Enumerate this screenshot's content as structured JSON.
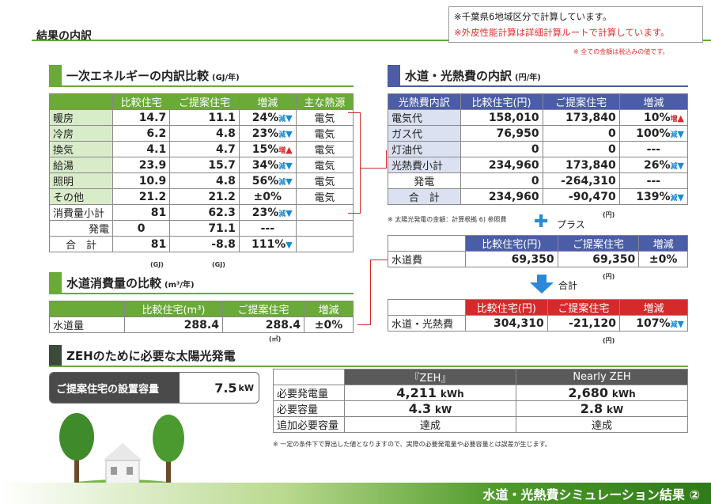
{
  "header": {
    "title": "結果の内訳",
    "note1": "※千葉県6地域区分で計算しています。",
    "note2": "※外皮性能計算は詳細計算ルートで計算しています。",
    "tax_note": "※ 全ての金額は税込みの値です。"
  },
  "energy": {
    "title": "一次エネルギーの内訳比較",
    "unit": "(GJ/年)",
    "headers": [
      "",
      "比較住宅",
      "ご提案住宅",
      "増減",
      "主な熱源"
    ],
    "rows": [
      {
        "label": "暖房",
        "a": "14.7",
        "b": "11.1",
        "pct": "24%",
        "tag": "減",
        "arrow": "▼",
        "src": "電気"
      },
      {
        "label": "冷房",
        "a": "6.2",
        "b": "4.8",
        "pct": "23%",
        "tag": "減",
        "arrow": "▼",
        "src": "電気"
      },
      {
        "label": "換気",
        "a": "4.1",
        "b": "4.7",
        "pct": "15%",
        "tag": "増",
        "arrow": "▲",
        "src": "電気"
      },
      {
        "label": "給湯",
        "a": "23.9",
        "b": "15.7",
        "pct": "34%",
        "tag": "減",
        "arrow": "▼",
        "src": "電気"
      },
      {
        "label": "照明",
        "a": "10.9",
        "b": "4.8",
        "pct": "56%",
        "tag": "減",
        "arrow": "▼",
        "src": "電気"
      },
      {
        "label": "その他",
        "a": "21.2",
        "b": "21.2",
        "pct": "±0%",
        "tag": "",
        "arrow": "",
        "src": "電気"
      }
    ],
    "subtotal": {
      "label": "消費量小計",
      "a": "81",
      "b": "62.3",
      "pct": "23%",
      "tag": "減",
      "arrow": "▼"
    },
    "gen": {
      "label": "発電",
      "a": "0",
      "b": "71.1",
      "pct": "---"
    },
    "total": {
      "label": "合　計",
      "a": "81",
      "b": "-8.8",
      "pct": "111%",
      "tag": "減",
      "arrow": "▼"
    },
    "unit_a": "(GJ)",
    "unit_b": "(GJ)"
  },
  "water": {
    "title": "水道消費量の比較",
    "unit": "(m³/年)",
    "headers": [
      "",
      "比較住宅(m³)",
      "ご提案住宅",
      "増減"
    ],
    "row": {
      "label": "水道量",
      "a": "288.4",
      "b": "288.4",
      "pct": "±0%"
    },
    "unit_note": "(㎥)"
  },
  "utility": {
    "title": "水道・光熱費の内訳",
    "unit": "(円/年)",
    "headers": [
      "光熱費内訳",
      "比較住宅(円)",
      "ご提案住宅",
      "増減"
    ],
    "rows": [
      {
        "label": "電気代",
        "a": "158,010",
        "b": "173,840",
        "pct": "10%",
        "tag": "増",
        "arrow": "▲"
      },
      {
        "label": "ガス代",
        "a": "76,950",
        "b": "0",
        "pct": "100%",
        "tag": "減",
        "arrow": "▼"
      },
      {
        "label": "灯油代",
        "a": "0",
        "b": "0",
        "pct": "---",
        "tag": "",
        "arrow": ""
      },
      {
        "label": "光熱費小計",
        "a": "234,960",
        "b": "173,840",
        "pct": "26%",
        "tag": "減",
        "arrow": "▼"
      },
      {
        "label": "発電",
        "a": "0",
        "b": "-264,310",
        "pct": "---",
        "tag": "",
        "arrow": ""
      },
      {
        "label": "合　計",
        "a": "234,960",
        "b": "-90,470",
        "pct": "139%",
        "tag": "減",
        "arrow": "▼"
      }
    ],
    "yen1": "(円)",
    "solar_note": "※ 太陽光発電の金額：計算根拠 6) 参照費",
    "plus": "プラス"
  },
  "waterfee": {
    "headers": [
      "",
      "比較住宅(円)",
      "ご提案住宅",
      "増減"
    ],
    "row": {
      "label": "水道費",
      "a": "69,350",
      "b": "69,350",
      "pct": "±0%"
    },
    "yen": "(円)",
    "sum_label": "合計"
  },
  "grand": {
    "headers": [
      "",
      "比較住宅(円)",
      "ご提案住宅",
      "増減"
    ],
    "row": {
      "label": "水道・光熱費",
      "a": "304,310",
      "b": "-21,120",
      "pct": "107%",
      "tag": "減",
      "arrow": "▼"
    },
    "yen": "(円)"
  },
  "zeh": {
    "title": "ZEHのために必要な太陽光発電",
    "cap_label": "ご提案住宅の設置容量",
    "cap_value": "7.5",
    "cap_unit": "kW",
    "headers": [
      "",
      "『ZEH』",
      "Nearly ZEH"
    ],
    "rows": [
      {
        "label": "必要発電量",
        "a": "4,211",
        "au": "kWh",
        "b": "2,680",
        "bu": "kWh"
      },
      {
        "label": "必要容量",
        "a": "4.3",
        "au": "kW",
        "b": "2.8",
        "bu": "kW"
      },
      {
        "label": "追加必要容量",
        "a": "達成",
        "au": "",
        "b": "達成",
        "bu": ""
      }
    ],
    "note": "※ 一定の条件下で算出した値となりますので、実際の必要発電量や必要容量とは誤差が生じます。"
  },
  "footer": {
    "title": "水道・光熱費シミュレーション結果 ②"
  },
  "colors": {
    "green": "#6aaa38",
    "blue": "#4a5da6",
    "red": "#d42a2a",
    "decrease": "#1a8ad0"
  }
}
